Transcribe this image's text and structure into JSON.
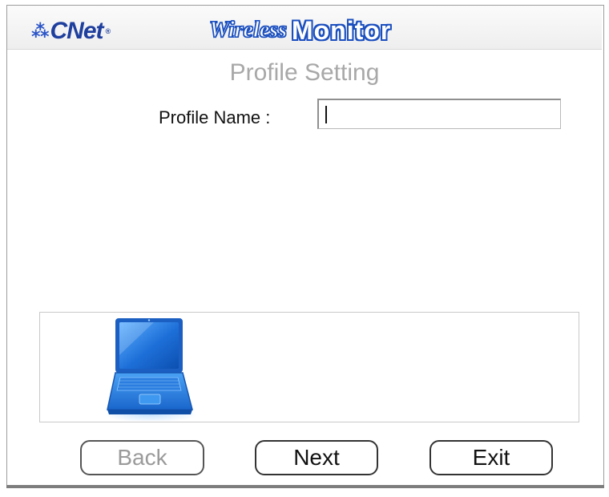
{
  "header": {
    "brand": "CNet",
    "brand_mark": "®",
    "brand_icon": "cnet-grid-logo-icon",
    "title_part1": "Wireless",
    "title_part2": "Monitor"
  },
  "page": {
    "section_title": "Profile Setting",
    "profile_name_label": "Profile Name :",
    "profile_name_value": ""
  },
  "illustration": {
    "icon": "laptop-icon"
  },
  "buttons": {
    "back": "Back",
    "next": "Next",
    "exit": "Exit",
    "back_disabled": true
  },
  "colors": {
    "brand_blue": "#1b4fbf",
    "section_title_gray": "#a8a8a8",
    "laptop_blue": "#3a8fe8"
  }
}
